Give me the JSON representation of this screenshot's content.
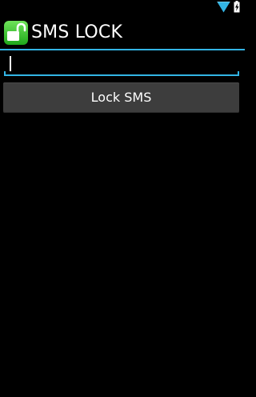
{
  "status_bar": {
    "icons": [
      "wifi-icon",
      "battery-charging-icon"
    ],
    "accent_color": "#33b5e5"
  },
  "action_bar": {
    "title": "SMS LOCK",
    "icon": "unlocked-padlock-icon",
    "icon_color": "#34c924"
  },
  "form": {
    "input_value": "",
    "button_label": "Lock SMS"
  },
  "colors": {
    "background": "#000000",
    "accent": "#33b5e5",
    "button": "#3d3d3d"
  }
}
